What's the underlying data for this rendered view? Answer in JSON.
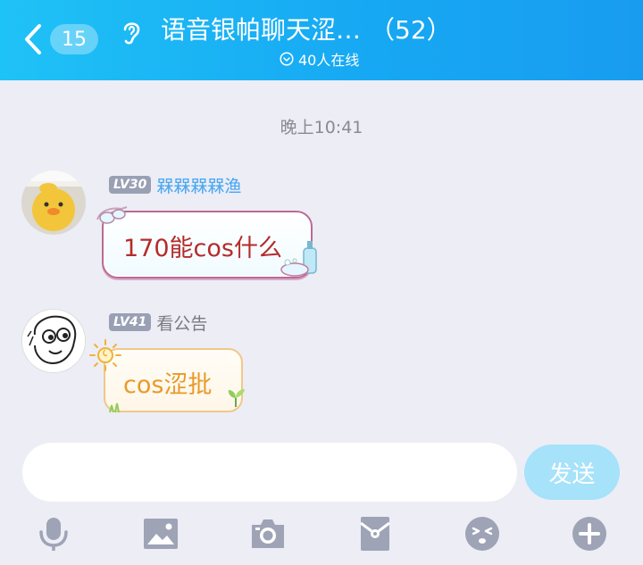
{
  "header": {
    "unread_count": "15",
    "title": "语音银帕聊天涩…",
    "member_count": "（52）",
    "online_status": "40人在线"
  },
  "chat": {
    "timestamp": "晚上10:41",
    "messages": [
      {
        "level": "LV30",
        "nickname": "槑槑槑槑渔",
        "text": "170能cos什么"
      },
      {
        "level": "LV41",
        "nickname": "看公告",
        "text": "cos涩批"
      }
    ]
  },
  "input": {
    "placeholder": "",
    "send_label": "发送"
  },
  "toolbar": {
    "icons": [
      "microphone-icon",
      "image-icon",
      "camera-icon",
      "red-packet-icon",
      "emoji-icon",
      "plus-icon"
    ]
  },
  "colors": {
    "header_start": "#1fc2f6",
    "header_end": "#189cf0",
    "background": "#ededf5",
    "send_button": "#a6e2fa",
    "toolbar_icon": "#9ea3b6",
    "message1_text": "#b52b2b",
    "message2_text": "#e89a28",
    "nickname1": "#4aa6f0"
  }
}
